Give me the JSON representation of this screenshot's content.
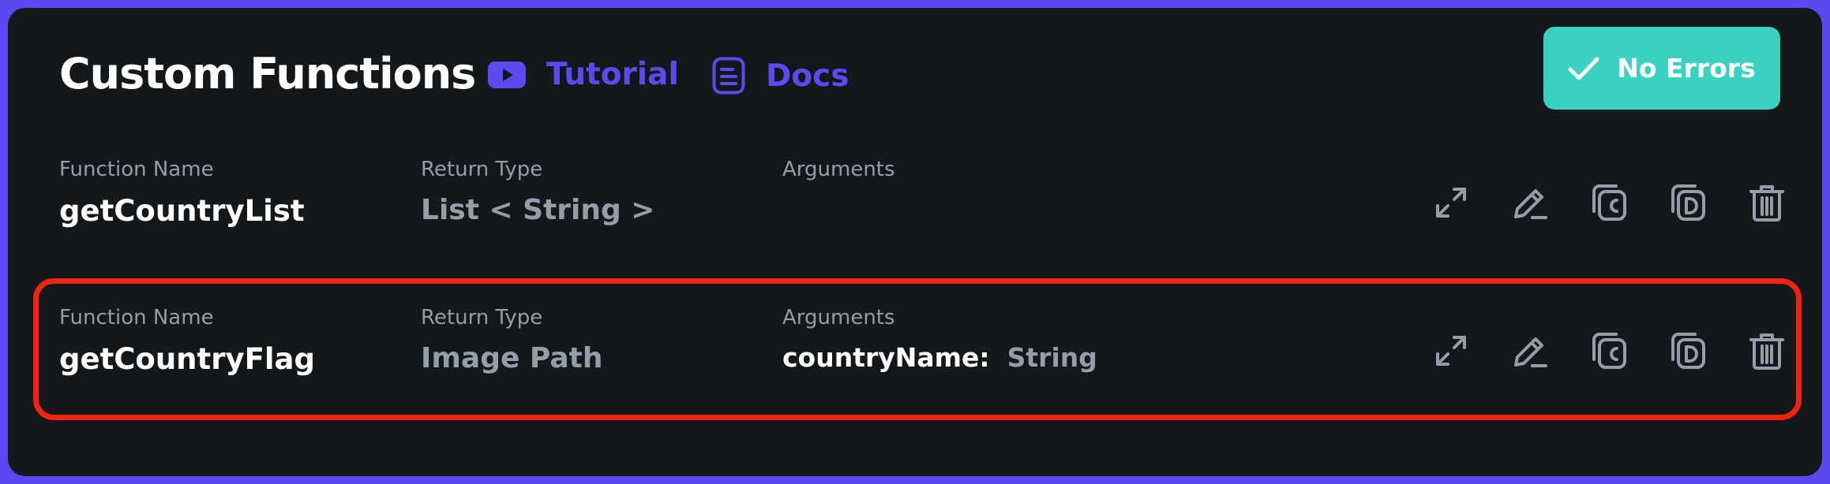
{
  "header": {
    "title": "Custom Functions",
    "tutorial_label": "Tutorial",
    "docs_label": "Docs",
    "status_label": "No Errors"
  },
  "functions": [
    {
      "name_label": "Function Name",
      "name": "getCountryList",
      "return_label": "Return Type",
      "return_type": "List < String >",
      "args_label": "Arguments",
      "arguments": []
    },
    {
      "name_label": "Function Name",
      "name": "getCountryFlag",
      "return_label": "Return Type",
      "return_type": "Image Path",
      "args_label": "Arguments",
      "arguments": [
        {
          "name": "countryName:",
          "type": "String"
        }
      ],
      "highlighted": true
    }
  ],
  "icons": [
    "youtube-icon",
    "document-icon",
    "check-icon",
    "expand-icon",
    "edit-icon",
    "copy-c-icon",
    "copy-d-icon",
    "trash-icon"
  ],
  "colors": {
    "frame": "#5a47f0",
    "panel": "#14181b",
    "accent": "#5b4af0",
    "success": "#39d2c0",
    "muted": "#959ea8",
    "highlight_border": "#ee2410"
  }
}
